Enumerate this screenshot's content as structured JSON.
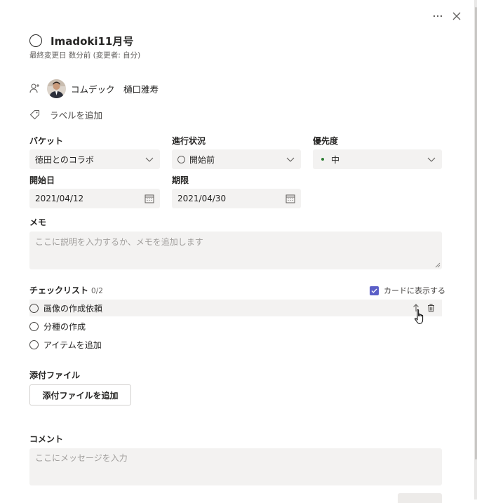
{
  "header": {
    "more_icon": "more-horizontal-icon",
    "close_icon": "close-icon"
  },
  "task": {
    "title": "Imadoki11月号",
    "modified": "最終変更日 数分前 (変更者: 自分)"
  },
  "assignment": {
    "assign_icon": "person-add-icon",
    "assignee": "コムデック　樋口雅寿"
  },
  "labels": {
    "add_label": "ラベルを追加"
  },
  "fields": {
    "bucket": {
      "label": "バケット",
      "value": "徳田とのコラボ"
    },
    "progress": {
      "label": "進行状況",
      "value": "開始前"
    },
    "priority": {
      "label": "優先度",
      "value": "中",
      "dot_color": "#2d7d33"
    },
    "start_date": {
      "label": "開始日",
      "value": "2021/04/12"
    },
    "due_date": {
      "label": "期限",
      "value": "2021/04/30"
    }
  },
  "memo": {
    "label": "メモ",
    "placeholder": "ここに説明を入力するか、メモを追加します"
  },
  "checklist": {
    "label": "チェックリスト",
    "count": "0/2",
    "show_on_card": "カードに表示する",
    "show_on_card_checked": true,
    "items": [
      {
        "text": "画像の作成依頼"
      },
      {
        "text": "分種の作成"
      }
    ],
    "add_item": "アイテムを追加"
  },
  "attachments": {
    "label": "添付ファイル",
    "add_button": "添付ファイルを追加"
  },
  "comments": {
    "label": "コメント",
    "placeholder": "ここにメッセージを入力"
  },
  "colors": {
    "accent": "#5b5fc7",
    "field_bg": "#f3f2f1"
  }
}
